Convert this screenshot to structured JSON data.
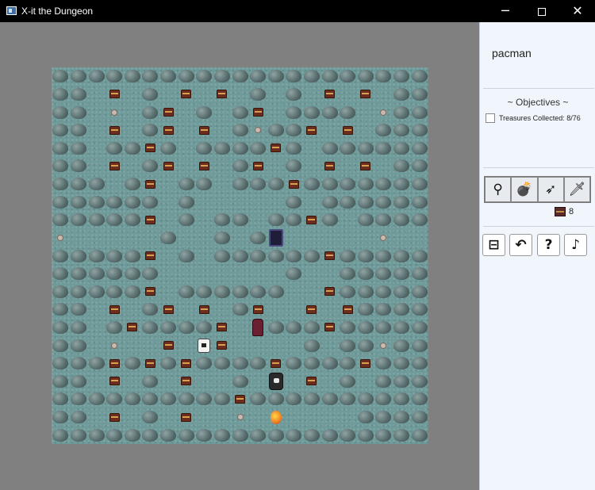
{
  "window": {
    "title": "X-it the Dungeon",
    "icon": "app-icon",
    "controls": {
      "minimize": "─",
      "close": "✕"
    }
  },
  "panel": {
    "player_name": "pacman",
    "objectives_title": "~ Objectives ~",
    "objectives": [
      {
        "label": "Treasures Collected: 8/76",
        "checked": false
      }
    ],
    "inventory": [
      {
        "icon": "key-icon",
        "glyph": "⚲"
      },
      {
        "icon": "bomb-icon",
        "glyph": "💣"
      },
      {
        "icon": "bow-icon",
        "glyph": "➶"
      },
      {
        "icon": "sword-icon",
        "glyph": "🗡"
      }
    ],
    "treasure_count": "8",
    "controls": [
      {
        "name": "exit-button",
        "icon": "door-icon",
        "glyph": "⊟"
      },
      {
        "name": "undo-button",
        "icon": "undo-icon",
        "glyph": "↶"
      },
      {
        "name": "help-button",
        "icon": "question-icon",
        "glyph": "?"
      },
      {
        "name": "music-button",
        "icon": "music-note-icon",
        "glyph": "♪"
      }
    ]
  },
  "game": {
    "grid_size": 21,
    "legend": {
      "R": "boulder",
      "C": "treasure-chest",
      "P": "potion",
      "D": "exit-door",
      "E": "enemy-knight",
      "G": "enemy-ghost",
      "S": "enemy-skeleton",
      "H": "player-hero",
      ".": "floor"
    },
    "map": [
      "RRRRRRRRRRRRRRRRRRRRR",
      "RR.C.R.C.C.R.R.C.C.RR",
      "RR.P.RC.R.RC.RRRR.PRR",
      "RR.C.RC.C.RPRRC.C.RRR",
      "RR.RRCR.RRRRCR.RRRRRR",
      "RR.C.RC.C.RC.R.C.C.RR",
      "RRR.RC.RR.RRRCRRRRRRR",
      "RRRRRR.R.....R.RRRRRR",
      "RRRRRC.R.RR.RRCR.RRRR",
      "P.....R..R.RD.....P..",
      "RRRRRC.R.RRRRRRCRRRRR",
      "RRRRRR.......R..RRRRR",
      "RRRRRC.RRRRRR..CRRRRR",
      "RR.C.RC.C.RC..C.CRRRR",
      "RR.RCRRRRC.ERRRCRRRRR",
      "RR.P..C.GC....R.RRPRR",
      "RRRCRCRCRRRRCRRRRCRRR",
      "RR.C.R.C..R.S.C.R.RRR",
      "RRRRRRRRRRCRRRRRRRRRR",
      "RR.C.R.C..P.H....RRRR",
      "RRRRRRRRRRRRRRRRRRRRR"
    ]
  },
  "colors": {
    "floor": "#6f9a9a",
    "panel_bg": "#f0f6fc",
    "title_bar": "#000000",
    "backdrop": "#808080"
  }
}
